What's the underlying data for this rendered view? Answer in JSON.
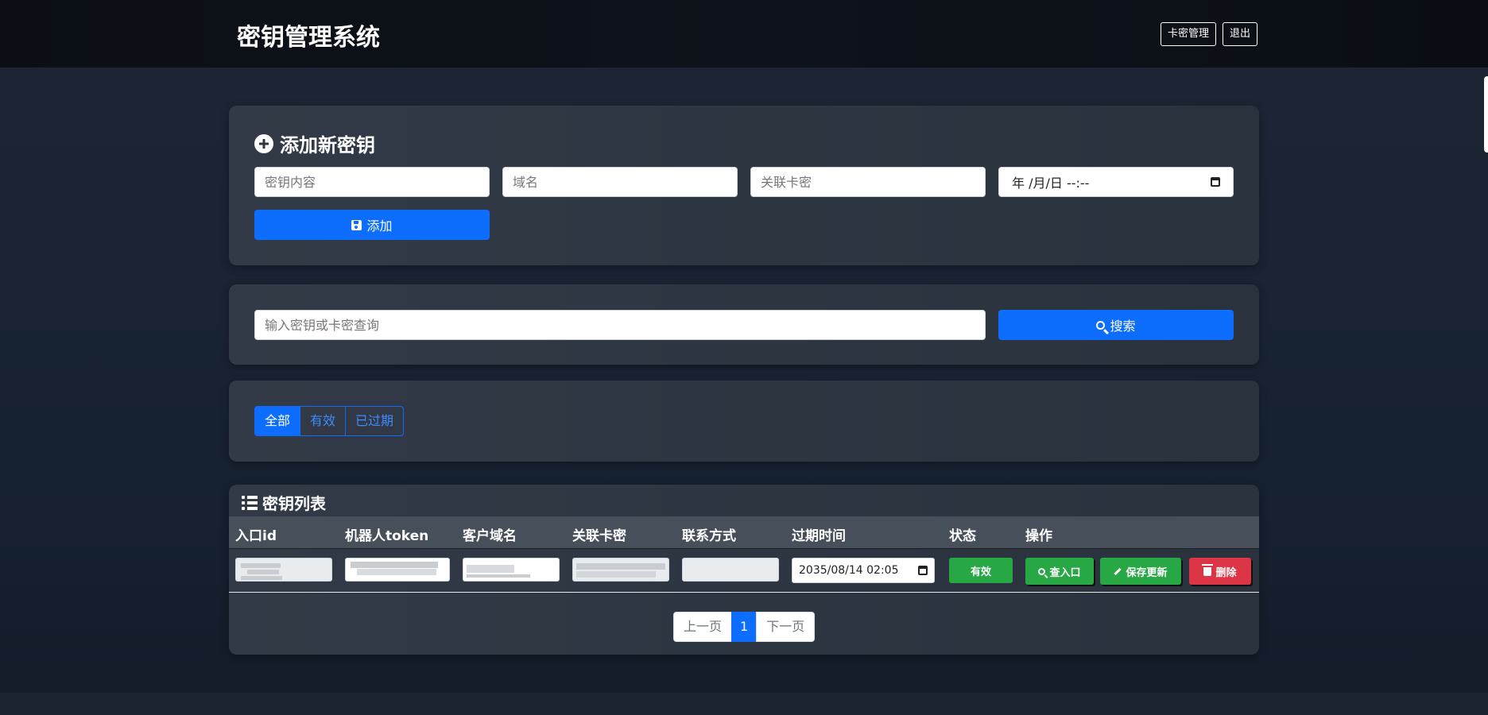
{
  "header": {
    "title": "密钥管理系统",
    "card_manage_label": "卡密管理",
    "logout_label": "退出"
  },
  "add_form": {
    "title": "添加新密钥",
    "key_placeholder": "密钥内容",
    "domain_placeholder": "域名",
    "card_placeholder": "关联卡密",
    "date_placeholder": "年 /月/日 --:--",
    "add_label": "添加"
  },
  "search": {
    "placeholder": "输入密钥或卡密查询",
    "button_label": "搜索"
  },
  "filters": {
    "items": [
      {
        "label": "全部",
        "active": true
      },
      {
        "label": "有效",
        "active": false
      },
      {
        "label": "已过期",
        "active": false
      }
    ]
  },
  "list": {
    "title": "密钥列表",
    "columns": [
      "入口id",
      "机器人token",
      "客户域名",
      "关联卡密",
      "联系方式",
      "过期时间",
      "状态",
      "操作"
    ],
    "rows": [
      {
        "expire": "2035/08/14 02:05",
        "status": "有效",
        "view_label": "查入口",
        "save_label": "保存更新",
        "delete_label": "删除"
      }
    ]
  },
  "pagination": {
    "prev_label": "上一页",
    "current_page": "1",
    "next_label": "下一页"
  },
  "colors": {
    "primary": "#0d6efd",
    "success": "#28a745",
    "danger": "#dc3545"
  }
}
